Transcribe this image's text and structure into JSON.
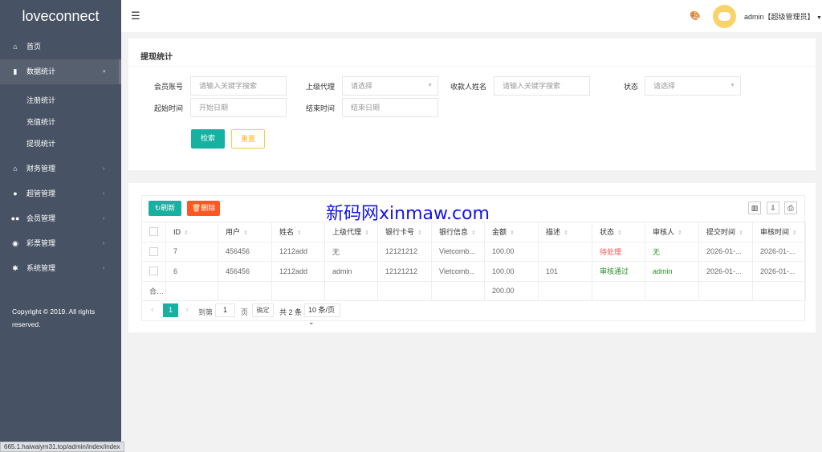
{
  "app": {
    "title": "loveconnect"
  },
  "sidebar": {
    "items": [
      {
        "label": "首页",
        "icon": "home-icon"
      },
      {
        "label": "数据统计",
        "icon": "bar-chart-icon",
        "active": true,
        "sub": [
          "注册统计",
          "充值统计",
          "提现统计"
        ]
      },
      {
        "label": "财务管理",
        "icon": "bank-icon"
      },
      {
        "label": "超管管理",
        "icon": "user-icon"
      },
      {
        "label": "会员管理",
        "icon": "users-icon"
      },
      {
        "label": "彩票管理",
        "icon": "gamepad-icon"
      },
      {
        "label": "系统管理",
        "icon": "gear-icon"
      }
    ],
    "copyright": "Copyright © 2019. All rights reserved."
  },
  "header": {
    "user": "admin【超级管理员】"
  },
  "search": {
    "title": "提现统计",
    "fields": [
      {
        "label": "会员账号",
        "placeholder": "请输入关键字搜索"
      },
      {
        "label": "上级代理",
        "placeholder": "请选择"
      },
      {
        "label": "收款人姓名",
        "placeholder": "请输入关键字搜索"
      },
      {
        "label": "状态",
        "placeholder": "请选择"
      },
      {
        "label": "起始时间",
        "placeholder": "开始日期"
      },
      {
        "label": "结束时间",
        "placeholder": "结束日期"
      }
    ],
    "search_btn": "检索",
    "reset_btn": "重置"
  },
  "toolbar": {
    "refresh": "刷新",
    "delete": "删除"
  },
  "watermark": "新码网xinmaw.com",
  "table": {
    "columns": [
      "ID",
      "用户",
      "姓名",
      "上级代理",
      "银行卡号",
      "银行信息",
      "金额",
      "描述",
      "状态",
      "审核人",
      "提交时间",
      "审核时间"
    ],
    "rows": [
      [
        "7",
        "456456",
        "1212add",
        "无",
        "12121212",
        "Vietcomb...",
        "100.00",
        "",
        "待处理",
        "无",
        "2026-01-...",
        "2026-01-..."
      ],
      [
        "6",
        "456456",
        "1212add",
        "admin",
        "12121212",
        "Vietcomb...",
        "100.00",
        "101",
        "审核通过",
        "admin",
        "2026-01-...",
        "2026-01-..."
      ]
    ],
    "total_label": "合...",
    "total_amount": "200.00"
  },
  "pager": {
    "current": "1",
    "goto": "到第",
    "page_input": "1",
    "page_unit": "页",
    "confirm": "确定",
    "total": "共 2 条",
    "page_size": "10 条/页"
  },
  "colors": {
    "sidebar": "#475364",
    "accent": "#16b1a0",
    "danger": "#ff5722",
    "pending": "#ff4d4f",
    "approved": "#2a8f2a"
  },
  "statusbar": "665.1.haiwaiym31.top/admin/index/index"
}
